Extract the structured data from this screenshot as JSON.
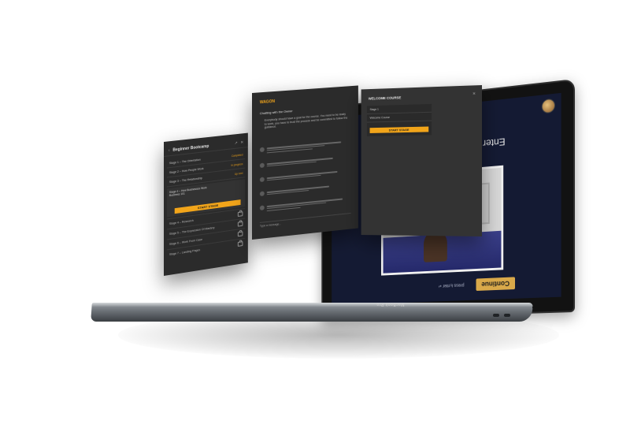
{
  "colors": {
    "accent": "#f2a51a",
    "panel_bg": "#2b2b2b",
    "display_bg": "#141a33"
  },
  "laptop": {
    "display_title": "Enter the W",
    "continue_label": "Continue",
    "enter_hint": "press Enter ↵",
    "brand_label": "MacBook Pro"
  },
  "left_panel": {
    "title": "Beginner Bootcamp",
    "back_icon": "chevron-left-icon",
    "rows": [
      {
        "label": "Stage 1 – The Orientation",
        "status": "Completed"
      },
      {
        "label": "Stage 2 – How People Work",
        "status": "In progress"
      },
      {
        "label": "Stage 3 – The Relationship",
        "status": "Up next"
      }
    ],
    "expanded": {
      "label": "Stage 4 – How Businesses Work",
      "sub": "Business 101",
      "button": "START STAGE"
    },
    "locked": [
      "Stage 4 – Research",
      "Stage 5 – The Expression Of Mastery",
      "Stage 6 – Work From Case",
      "Stage 7 – Landing Pages"
    ]
  },
  "mid_panel": {
    "brand": "WAGON",
    "header": "Chatting with the Owner",
    "intro": "Everybody should have a goal for the course. You need to be ready to work, you have to trust the process and be committed to follow the guidance.",
    "input_placeholder": "Type a message..."
  },
  "right_panel": {
    "title": "WELCOME COURSE",
    "stage_label": "Stage 1",
    "stage_detail": "Welcome Course",
    "button": "START STAGE"
  }
}
